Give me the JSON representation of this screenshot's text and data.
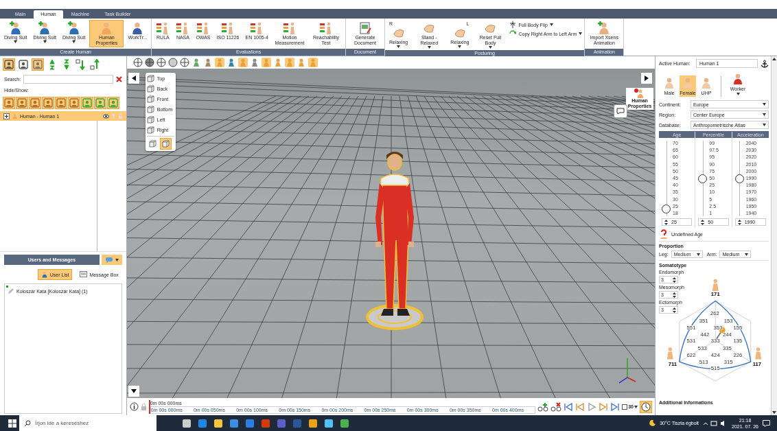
{
  "tabs": [
    {
      "label": "Main",
      "selected": false
    },
    {
      "label": "Human",
      "selected": true
    },
    {
      "label": "Machine",
      "selected": false
    },
    {
      "label": "Task Builder",
      "selected": false
    }
  ],
  "ribbon": [
    {
      "title": "Create Human",
      "buttons": [
        {
          "label": "Diving Suit",
          "dropdown": true,
          "selected": false
        },
        {
          "label": "Diving Suit",
          "dropdown": true,
          "selected": false
        },
        {
          "label": "Diving Suit",
          "dropdown": true,
          "selected": false
        },
        {
          "label": "Human Properties",
          "dropdown": false,
          "selected": true
        },
        {
          "label": "WorkTr...",
          "dropdown": false,
          "selected": false
        }
      ]
    },
    {
      "title": "Evaluations",
      "buttons": [
        {
          "label": "RULA",
          "dropdown": false,
          "selected": false
        },
        {
          "label": "NASA",
          "dropdown": false,
          "selected": false
        },
        {
          "label": "OWAS",
          "dropdown": false,
          "selected": false
        },
        {
          "label": "ISO 11226",
          "dropdown": false,
          "selected": false
        },
        {
          "label": "EN 1005-4",
          "dropdown": false,
          "selected": false
        },
        {
          "label": "Motion Measurement",
          "dropdown": false,
          "selected": false
        },
        {
          "label": "Reachability Test",
          "dropdown": false,
          "selected": false
        }
      ]
    },
    {
      "title": "Document",
      "buttons": [
        {
          "label": "Generate Document",
          "dropdown": false,
          "selected": false
        }
      ]
    },
    {
      "title": "Posturing",
      "buttons": [
        {
          "label": "Relaxing",
          "dropdown": true,
          "selected": false,
          "marker": "R"
        },
        {
          "label": "Stand - Relaxed",
          "dropdown": true,
          "selected": false
        },
        {
          "label": "Relaxing",
          "dropdown": true,
          "selected": false,
          "marker": "L"
        },
        {
          "label": "Reset Full Body",
          "dropdown": true,
          "selected": false
        }
      ],
      "small_buttons": [
        {
          "label": "Full Body Flip",
          "dropdown": true
        },
        {
          "label": "Copy Right Arm to Left Arm",
          "dropdown": true
        }
      ]
    },
    {
      "title": "Animation",
      "buttons": [
        {
          "label": "Import Xsens Animation",
          "dropdown": false,
          "selected": false
        }
      ]
    }
  ],
  "left_panel": {
    "search_label": "Search:",
    "hide_show_label": "Hide/Show:",
    "tree": [
      {
        "label": "Human - Human 1",
        "selected": true,
        "expanded": false
      }
    ]
  },
  "users": {
    "title": "Users and Messages",
    "tabs": [
      {
        "label": "User List",
        "selected": true
      },
      {
        "label": "Message Box",
        "selected": false
      }
    ],
    "list": [
      {
        "name": "Koloszár Kata [Koloszár Kata] (1)",
        "online": true
      }
    ]
  },
  "viewport": {
    "view_menu": [
      "Top",
      "Back",
      "Front",
      "Bottom",
      "Left",
      "Right"
    ],
    "projection": [
      {
        "selected": false
      },
      {
        "selected": true
      }
    ],
    "side_label": "Human Properties"
  },
  "timeline": {
    "current": "0m 00s 000ms",
    "ticks": [
      "0m 00s 000ms",
      "0m 00s 050ms",
      "0m 00s 100ms",
      "0m 00s 150ms",
      "0m 00s 200ms",
      "0m 00s 250ms",
      "0m 00s 300ms",
      "0m 00s 350ms",
      "0m 00s 400ms"
    ],
    "fps": "30"
  },
  "right_panel": {
    "active_label": "Active Human:",
    "active_value": "Human 1",
    "body_types": [
      {
        "label": "Male",
        "selected": false
      },
      {
        "label": "Female",
        "selected": true
      },
      {
        "label": "UHP",
        "selected": false
      }
    ],
    "worker": "Worker",
    "selects": [
      {
        "label": "Continent:",
        "value": "Europe"
      },
      {
        "label": "Region:",
        "value": "Center Europe"
      },
      {
        "label": "Database:",
        "value": "Anthropometrische Atlas"
      }
    ],
    "sliders": [
      {
        "title": "Age",
        "ticks": [
          "70",
          "65",
          "60",
          "55",
          "50",
          "45",
          "40",
          "35",
          "30",
          "25",
          "18"
        ],
        "level": 0.1,
        "value": "25"
      },
      {
        "title": "Percentile",
        "ticks": [
          "99",
          "97.5",
          "95",
          "90",
          "75",
          "50",
          "25",
          "10",
          "5",
          "2.5",
          "1"
        ],
        "level": 0.5,
        "value": "50"
      },
      {
        "title": "Acceleration",
        "ticks": [
          "2040",
          "2030",
          "2020",
          "2010",
          "2000",
          "1990",
          "1980",
          "1970",
          "1960",
          "1950",
          "1940"
        ],
        "level": 0.5,
        "value": "1990"
      }
    ],
    "undefined_age": "Undefined Age",
    "proportion": {
      "title": "Proportion",
      "fields": [
        {
          "label": "Leg:",
          "value": "Medium"
        },
        {
          "label": "Arm:",
          "value": "Medium"
        }
      ]
    },
    "somatotype": {
      "title": "Somatotype",
      "fields": [
        {
          "label": "Endomorph",
          "value": "3"
        },
        {
          "label": "Mesomorph",
          "value": "3"
        },
        {
          "label": "Ectomorph",
          "value": "3"
        }
      ],
      "vertices": [
        "171",
        "711",
        "117"
      ],
      "labels": [
        "262",
        "351",
        "153",
        "551",
        "353",
        "155",
        "442",
        "244",
        "531",
        "333",
        "135",
        "533",
        "335",
        "622",
        "424",
        "226",
        "513",
        "315",
        "515"
      ]
    },
    "additional": "Additional Informations"
  },
  "taskbar": {
    "search_placeholder": "Írjon ide a kereséshez",
    "weather": "30°C Tiszta égbolt",
    "time": "21:18",
    "date": "2021. 07. 26"
  }
}
